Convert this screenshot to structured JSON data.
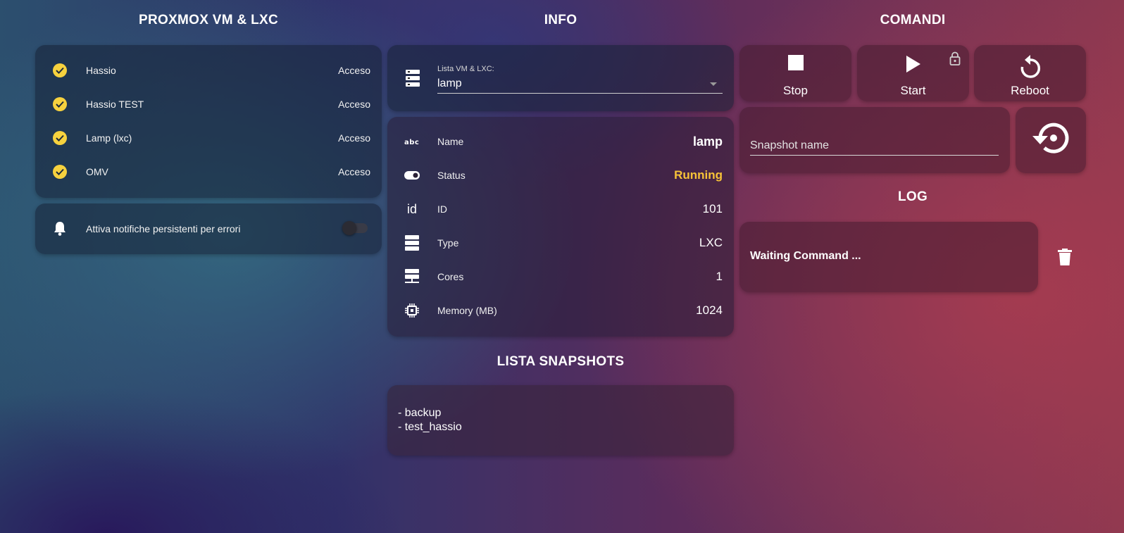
{
  "columns": {
    "left_title": "PROXMOX VM & LXC",
    "middle_title": "INFO",
    "right_title": "COMANDI"
  },
  "vm_list": [
    {
      "name": "Hassio",
      "state": "Acceso"
    },
    {
      "name": "Hassio TEST",
      "state": "Acceso"
    },
    {
      "name": "Lamp (lxc)",
      "state": "Acceso"
    },
    {
      "name": "OMV",
      "state": "Acceso"
    }
  ],
  "notifications": {
    "label": "Attiva notifiche persistenti per errori",
    "enabled": false
  },
  "selector": {
    "label": "Lista VM & LXC:",
    "value": "lamp"
  },
  "info": [
    {
      "icon": "abc-icon",
      "key": "Name",
      "value": "lamp"
    },
    {
      "icon": "toggle-status-icon",
      "key": "Status",
      "value": "Running"
    },
    {
      "icon": "id-icon",
      "key": "ID",
      "value": "101"
    },
    {
      "icon": "server-icon",
      "key": "Type",
      "value": "LXC"
    },
    {
      "icon": "server-network-icon",
      "key": "Cores",
      "value": "1"
    },
    {
      "icon": "chip-icon",
      "key": "Memory (MB)",
      "value": "1024"
    }
  ],
  "snapshots": {
    "title": "LISTA SNAPSHOTS",
    "items": [
      "- backup",
      "- test_hassio"
    ]
  },
  "commands": {
    "stop": "Stop",
    "start": "Start",
    "reboot": "Reboot"
  },
  "snapshot_input": {
    "placeholder": "Snapshot name"
  },
  "log": {
    "title": "LOG",
    "text": "Waiting Command ..."
  },
  "colors": {
    "check": "#f7d23e",
    "running": "#f7c338"
  }
}
